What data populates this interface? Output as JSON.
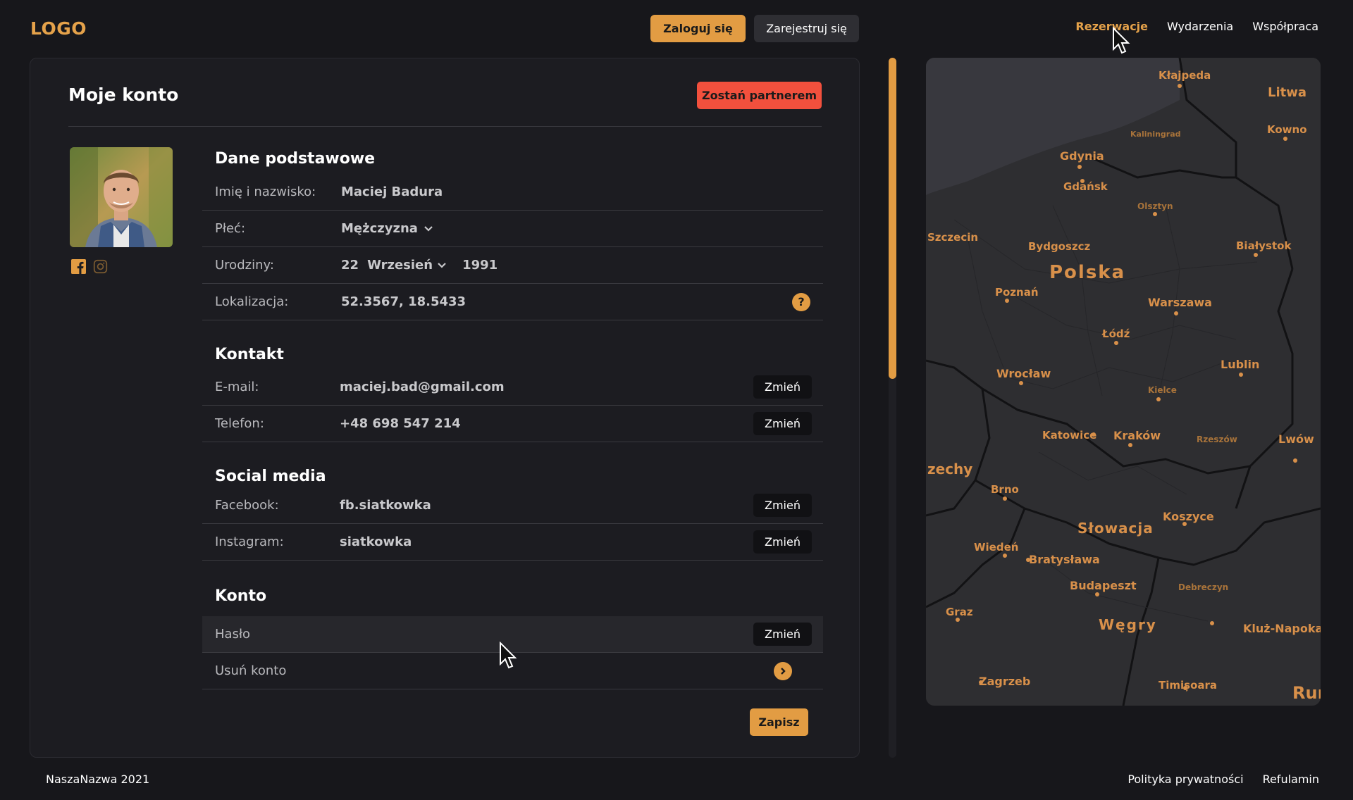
{
  "header": {
    "logo": "LOGO",
    "login_label": "Zaloguj się",
    "register_label": "Zarejestruj się",
    "nav": [
      {
        "label": "Rezerwacje",
        "active": true
      },
      {
        "label": "Wydarzenia",
        "active": false
      },
      {
        "label": "Współpraca",
        "active": false
      }
    ]
  },
  "account": {
    "title": "Moje konto",
    "partner_label": "Zostań partnerem",
    "sections": {
      "basic": {
        "title": "Dane podstawowe",
        "name_label": "Imię i nazwisko:",
        "name_value": "Maciej Badura",
        "gender_label": "Płeć:",
        "gender_value": "Mężczyzna",
        "birthday_label": "Urodziny:",
        "birth_day": "22",
        "birth_month": "Wrzesień",
        "birth_year": "1991",
        "location_label": "Lokalizacja:",
        "location_value": "52.3567, 18.5433"
      },
      "contact": {
        "title": "Kontakt",
        "email_label": "E-mail:",
        "email_value": "maciej.bad@gmail.com",
        "phone_label": "Telefon:",
        "phone_value": "+48 698 547 214"
      },
      "social": {
        "title": "Social media",
        "facebook_label": "Facebook:",
        "facebook_value": "fb.siatkowka",
        "instagram_label": "Instagram:",
        "instagram_value": "siatkowka"
      },
      "konto": {
        "title": "Konto",
        "password_label": "Hasło",
        "delete_label": "Usuń konto"
      }
    },
    "change_label": "Zmień",
    "save_label": "Zapisz"
  },
  "map": {
    "labels": [
      {
        "text": "Kłajpeda"
      },
      {
        "text": "Litwa"
      },
      {
        "text": "Kowno"
      },
      {
        "text": "Kaliningrad"
      },
      {
        "text": "Gdynia"
      },
      {
        "text": "Gdańsk"
      },
      {
        "text": "Olsztyn"
      },
      {
        "text": "Szczecin"
      },
      {
        "text": "Bydgoszcz"
      },
      {
        "text": "Białystok"
      },
      {
        "text": "Polska"
      },
      {
        "text": "Poznań"
      },
      {
        "text": "Warszawa"
      },
      {
        "text": "Łódź"
      },
      {
        "text": "Wrocław"
      },
      {
        "text": "Lublin"
      },
      {
        "text": "Kielce"
      },
      {
        "text": "Katowice"
      },
      {
        "text": "Kraków"
      },
      {
        "text": "Rzeszów"
      },
      {
        "text": "Lwów"
      },
      {
        "text": "zechy"
      },
      {
        "text": "Brno"
      },
      {
        "text": "Koszyce"
      },
      {
        "text": "Słowacja"
      },
      {
        "text": "Wiedeń"
      },
      {
        "text": "Bratysława"
      },
      {
        "text": "Budapeszt"
      },
      {
        "text": "Debreczyn"
      },
      {
        "text": "Graz"
      },
      {
        "text": "Węgry"
      },
      {
        "text": "Kluż-Napoka"
      },
      {
        "text": "Zagrzeb"
      },
      {
        "text": "Timișoara"
      },
      {
        "text": "Rur"
      }
    ]
  },
  "footer": {
    "copyright": "NaszaNazwa 2021",
    "privacy": "Polityka prywatności",
    "terms": "Refulamin"
  },
  "colors": {
    "accent": "#e29c43",
    "danger": "#f2503d",
    "background": "#17171b",
    "panel": "#1c1c21"
  }
}
